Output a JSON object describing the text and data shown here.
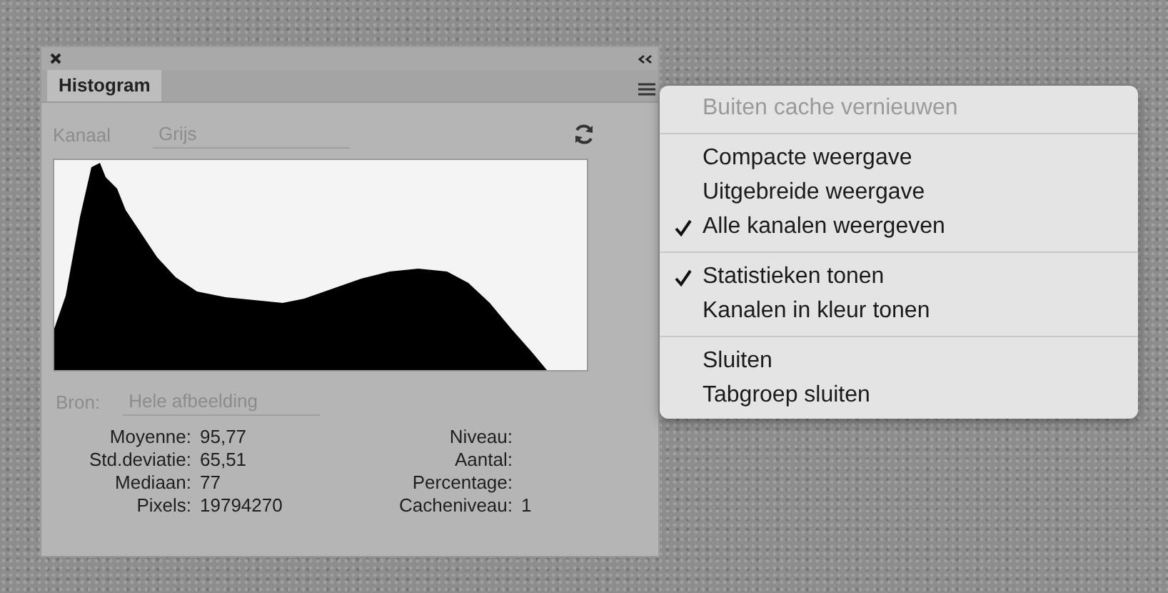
{
  "panel": {
    "tab": {
      "label": "Histogram",
      "selected": true
    },
    "channel": {
      "label": "Kanaal",
      "value": "Grijs",
      "disabled": true
    },
    "source": {
      "label": "Bron:",
      "value": "Hele afbeelding",
      "disabled": true
    },
    "stats_left": [
      {
        "label": "Moyenne:",
        "value": "95,77"
      },
      {
        "label": "Std.deviatie:",
        "value": "65,51"
      },
      {
        "label": "Mediaan:",
        "value": "77"
      },
      {
        "label": "Pixels:",
        "value": "19794270"
      }
    ],
    "stats_right": [
      {
        "label": "Niveau:"
      },
      {
        "label": "Aantal:"
      },
      {
        "label": "Percentage:"
      },
      {
        "label": "Cacheniveau:",
        "value": "1"
      }
    ]
  },
  "menu": {
    "groups": [
      [
        {
          "label": "Buiten cache vernieuwen",
          "disabled": true,
          "checked": false
        }
      ],
      [
        {
          "label": "Compacte weergave",
          "disabled": false,
          "checked": false
        },
        {
          "label": "Uitgebreide weergave",
          "disabled": false,
          "checked": false
        },
        {
          "label": "Alle kanalen weergeven",
          "disabled": false,
          "checked": true
        }
      ],
      [
        {
          "label": "Statistieken tonen",
          "disabled": false,
          "checked": true
        },
        {
          "label": "Kanalen in kleur tonen",
          "disabled": false,
          "checked": false
        }
      ],
      [
        {
          "label": "Sluiten",
          "disabled": false,
          "checked": false
        },
        {
          "label": "Tabgroep sluiten",
          "disabled": false,
          "checked": false
        }
      ]
    ]
  }
}
